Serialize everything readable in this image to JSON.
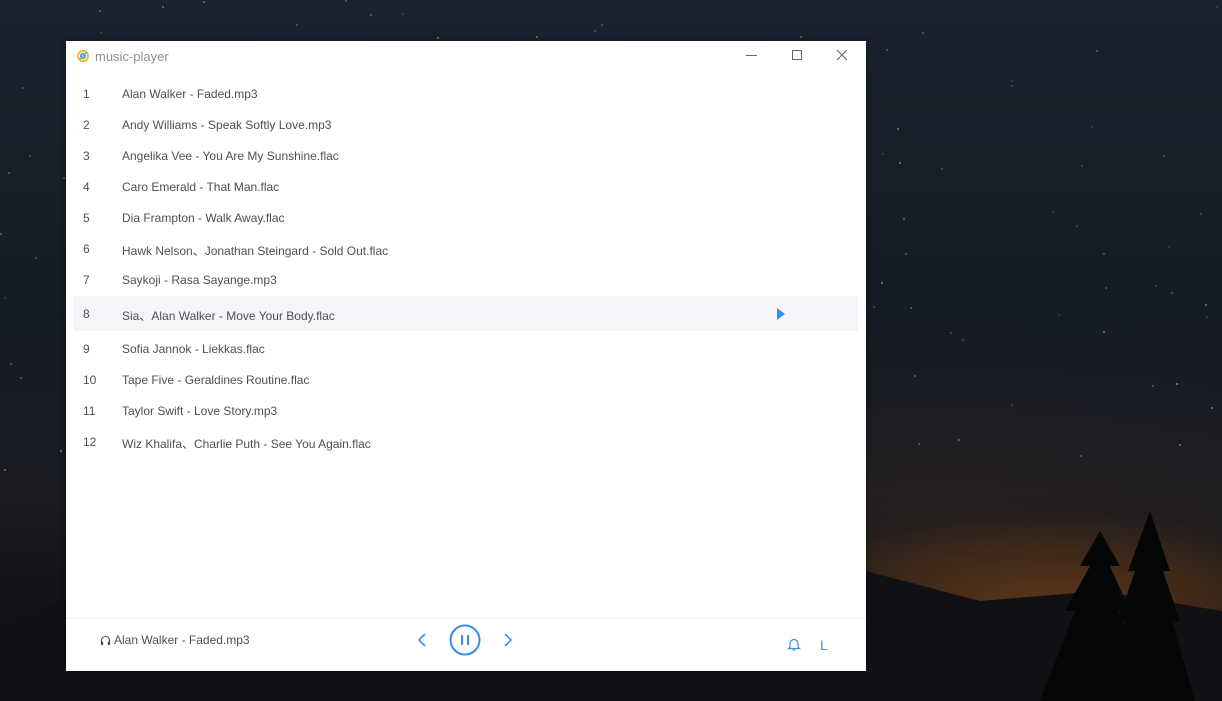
{
  "window": {
    "title": "music-player"
  },
  "playlist": [
    {
      "index": "1",
      "name": "Alan Walker - Faded.mp3"
    },
    {
      "index": "2",
      "name": "Andy Williams - Speak Softly Love.mp3"
    },
    {
      "index": "3",
      "name": "Angelika Vee - You Are My Sunshine.flac"
    },
    {
      "index": "4",
      "name": "Caro Emerald - That Man.flac"
    },
    {
      "index": "5",
      "name": "Dia Frampton - Walk Away.flac"
    },
    {
      "index": "6",
      "name": "Hawk Nelson、Jonathan Steingard - Sold Out.flac"
    },
    {
      "index": "7",
      "name": "Saykoji - Rasa Sayange.mp3"
    },
    {
      "index": "8",
      "name": "Sia、Alan Walker - Move Your Body.flac"
    },
    {
      "index": "9",
      "name": "Sofia Jannok - Liekkas.flac"
    },
    {
      "index": "10",
      "name": "Tape Five - Geraldines Routine.flac"
    },
    {
      "index": "11",
      "name": "Taylor Swift - Love Story.mp3"
    },
    {
      "index": "12",
      "name": "Wiz Khalifa、Charlie Puth - See You Again.flac"
    }
  ],
  "player": {
    "now_playing": "Alan Walker - Faded.mp3",
    "mode_label": "L",
    "state": "playing"
  },
  "icons": {
    "app": "app-logo-icon",
    "minimize": "minimize-icon",
    "maximize": "maximize-icon",
    "close": "close-icon",
    "row_play": "play-icon",
    "headphones": "headphones-icon",
    "prev": "chevron-left-icon",
    "pause": "pause-circle-icon",
    "next": "chevron-right-icon",
    "notify": "bell-icon"
  },
  "colors": {
    "accent": "#3a8ee6",
    "text": "#4b4f56",
    "title": "#8a8f97",
    "row_hover": "#f4f5f8"
  }
}
